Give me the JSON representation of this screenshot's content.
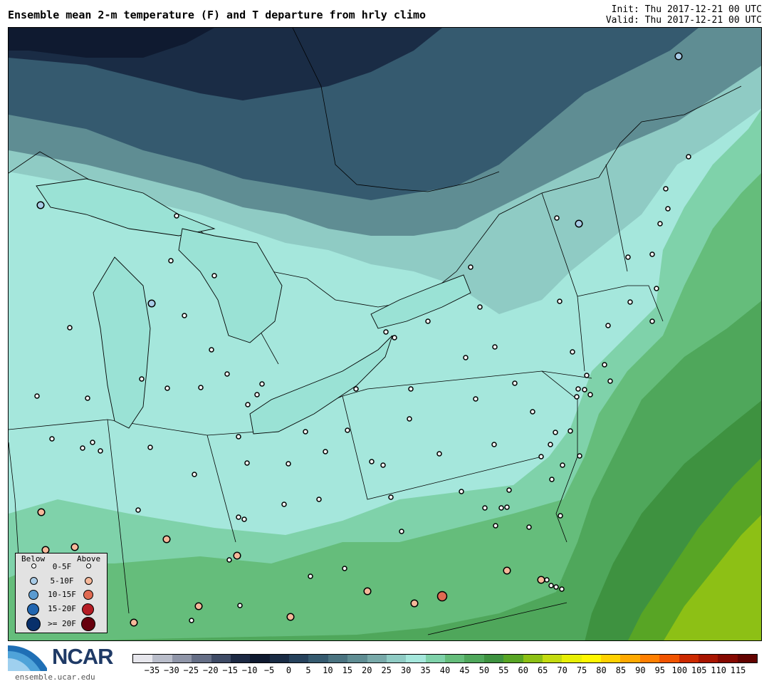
{
  "header": {
    "title": "Ensemble mean 2-m temperature (F) and T departure from hrly climo",
    "init": "Init: Thu 2017-12-21 00 UTC",
    "valid": "Valid: Thu 2017-12-21 00 UTC"
  },
  "legend": {
    "below_label": "Below",
    "above_label": "Above",
    "rows": [
      {
        "label": "0-5F",
        "below_color": "#ffffff",
        "above_color": "#ffffff"
      },
      {
        "label": "5-10F",
        "below_color": "#a8cbe6",
        "above_color": "#f6b89a"
      },
      {
        "label": "10-15F",
        "below_color": "#5b9bd0",
        "above_color": "#e06a52"
      },
      {
        "label": "15-20F",
        "below_color": "#2266b0",
        "above_color": "#b51d25"
      },
      {
        "label": ">= 20F",
        "below_color": "#08306b",
        "above_color": "#67000d"
      }
    ]
  },
  "footer": {
    "logo_text": "NCAR",
    "site": "ensemble.ucar.edu"
  },
  "colorbar": {
    "ticks": [
      "−35",
      "−30",
      "−25",
      "−20",
      "−15",
      "−10",
      "−5",
      "0",
      "5",
      "10",
      "15",
      "20",
      "25",
      "30",
      "35",
      "40",
      "45",
      "50",
      "55",
      "60",
      "65",
      "70",
      "75",
      "80",
      "85",
      "90",
      "95",
      "100",
      "105",
      "110",
      "115"
    ],
    "colors": [
      "#e6e6ec",
      "#b9bdca",
      "#8f95a8",
      "#656e86",
      "#3f4b66",
      "#1d2a44",
      "#0f1a30",
      "#1a2c45",
      "#26425c",
      "#355a6f",
      "#4a7380",
      "#5f8d93",
      "#78a9a9",
      "#8fcbc4",
      "#a5e7dc",
      "#7fd2aa",
      "#65bd7b",
      "#4fa75b",
      "#3e9240",
      "#58a525",
      "#8dc015",
      "#c4db10",
      "#e8ef05",
      "#fff700",
      "#ffd100",
      "#ffa900",
      "#ff7f00",
      "#f05400",
      "#cc2a00",
      "#a81500",
      "#850900",
      "#630300"
    ]
  },
  "stations": {
    "below_small": [
      [
        56,
        287
      ],
      [
        212,
        425
      ],
      [
        812,
        313
      ],
      [
        952,
        78
      ]
    ],
    "above_small": [
      [
        57,
        718
      ],
      [
        63,
        771
      ],
      [
        104,
        767
      ],
      [
        233,
        756
      ],
      [
        332,
        779
      ],
      [
        278,
        850
      ],
      [
        187,
        873
      ],
      [
        407,
        865
      ],
      [
        515,
        829
      ],
      [
        581,
        846
      ],
      [
        711,
        800
      ],
      [
        759,
        813
      ]
    ],
    "above_medium": [
      [
        620,
        836
      ]
    ],
    "zero": [
      [
        247,
        302
      ],
      [
        239,
        365
      ],
      [
        300,
        386
      ],
      [
        258,
        442
      ],
      [
        97,
        459
      ],
      [
        296,
        490
      ],
      [
        318,
        524
      ],
      [
        281,
        543
      ],
      [
        234,
        544
      ],
      [
        198,
        531
      ],
      [
        122,
        558
      ],
      [
        51,
        555
      ],
      [
        72,
        615
      ],
      [
        129,
        620
      ],
      [
        115,
        628
      ],
      [
        140,
        632
      ],
      [
        210,
        627
      ],
      [
        334,
        612
      ],
      [
        346,
        649
      ],
      [
        404,
        650
      ],
      [
        272,
        665
      ],
      [
        193,
        715
      ],
      [
        334,
        725
      ],
      [
        342,
        728
      ],
      [
        398,
        707
      ],
      [
        447,
        700
      ],
      [
        428,
        605
      ],
      [
        456,
        633
      ],
      [
        487,
        603
      ],
      [
        521,
        647
      ],
      [
        537,
        652
      ],
      [
        548,
        697
      ],
      [
        563,
        745
      ],
      [
        483,
        797
      ],
      [
        435,
        808
      ],
      [
        336,
        849
      ],
      [
        321,
        785
      ],
      [
        268,
        870
      ],
      [
        360,
        553
      ],
      [
        347,
        567
      ],
      [
        367,
        538
      ],
      [
        499,
        545
      ],
      [
        541,
        465
      ],
      [
        553,
        473
      ],
      [
        600,
        450
      ],
      [
        576,
        545
      ],
      [
        574,
        587
      ],
      [
        616,
        636
      ],
      [
        653,
        501
      ],
      [
        667,
        559
      ],
      [
        660,
        374
      ],
      [
        673,
        430
      ],
      [
        694,
        486
      ],
      [
        722,
        537
      ],
      [
        747,
        577
      ],
      [
        693,
        623
      ],
      [
        779,
        606
      ],
      [
        772,
        623
      ],
      [
        759,
        640
      ],
      [
        789,
        652
      ],
      [
        813,
        639
      ],
      [
        800,
        604
      ],
      [
        811,
        545
      ],
      [
        809,
        556
      ],
      [
        820,
        546
      ],
      [
        823,
        526
      ],
      [
        828,
        553
      ],
      [
        848,
        511
      ],
      [
        856,
        534
      ],
      [
        853,
        456
      ],
      [
        803,
        493
      ],
      [
        785,
        422
      ],
      [
        781,
        305
      ],
      [
        881,
        360
      ],
      [
        884,
        423
      ],
      [
        915,
        356
      ],
      [
        915,
        450
      ],
      [
        921,
        404
      ],
      [
        926,
        313
      ],
      [
        937,
        292
      ],
      [
        934,
        264
      ],
      [
        966,
        219
      ],
      [
        647,
        689
      ],
      [
        680,
        712
      ],
      [
        703,
        712
      ],
      [
        711,
        711
      ],
      [
        714,
        687
      ],
      [
        742,
        739
      ],
      [
        695,
        737
      ],
      [
        774,
        672
      ],
      [
        786,
        723
      ],
      [
        767,
        813
      ],
      [
        773,
        821
      ],
      [
        780,
        823
      ],
      [
        788,
        826
      ]
    ]
  }
}
